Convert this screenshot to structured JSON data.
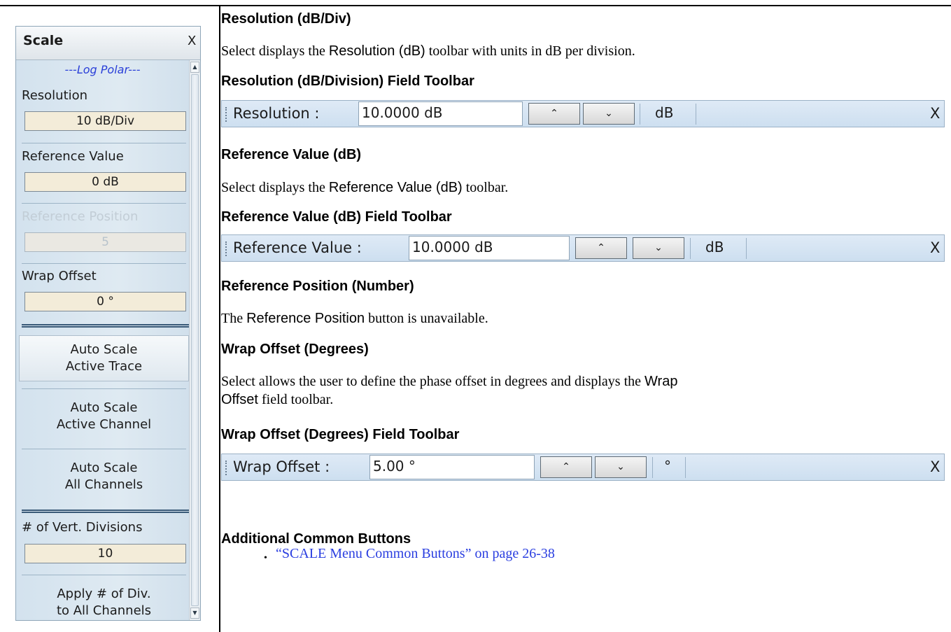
{
  "panel": {
    "title": "Scale",
    "close_label": "X",
    "subtitle": "---Log Polar---",
    "resolution": {
      "label": "Resolution",
      "value": "10 dB/Div"
    },
    "reference_value": {
      "label": "Reference Value",
      "value": "0 dB"
    },
    "reference_position": {
      "label": "Reference Position",
      "value": "5"
    },
    "wrap_offset": {
      "label": "Wrap Offset",
      "value": "0 °"
    },
    "auto_scale_trace": {
      "line1": "Auto Scale",
      "line2": "Active Trace"
    },
    "auto_scale_channel": {
      "line1": "Auto Scale",
      "line2": "Active Channel"
    },
    "auto_scale_all": {
      "line1": "Auto Scale",
      "line2": "All Channels"
    },
    "vert_divisions": {
      "label": "# of Vert. Divisions",
      "value": "10"
    },
    "apply_div": {
      "line1": "Apply # of Div.",
      "line2": "to All Channels"
    },
    "scroll_up": "▲",
    "scroll_down": "▼"
  },
  "doc": {
    "h_resolution": "Resolution (dB/Div)",
    "p_resolution_pre": "Select displays the ",
    "p_resolution_term": "Resolution (dB)",
    "p_resolution_post": " toolbar with units in dB per division.",
    "h_resolution_toolbar": "Resolution (dB/Division) Field Toolbar",
    "h_refval": "Reference Value (dB)",
    "p_refval_pre": "Select displays the ",
    "p_refval_term": "Reference Value (dB)",
    "p_refval_post": " toolbar.",
    "h_refval_toolbar": "Reference Value (dB) Field Toolbar",
    "h_refpos": "Reference Position (Number)",
    "p_refpos_pre": "The ",
    "p_refpos_term": "Reference Position",
    "p_refpos_post": " button is unavailable.",
    "h_wrap": "Wrap Offset (Degrees)",
    "p_wrap_line1_pre": "Select allows the user to define the phase offset in degrees and displays the ",
    "p_wrap_line1_term": "Wrap",
    "p_wrap_line2_term": "Offset",
    "p_wrap_line2_post": " field toolbar.",
    "h_wrap_toolbar": "Wrap Offset (Degrees) Field Toolbar",
    "h_additional": "Additional Common Buttons",
    "bullet": "•",
    "link": "“SCALE Menu Common Buttons” on page 26-38"
  },
  "toolbars": {
    "resolution": {
      "label": "Resolution :",
      "value": "10.0000  dB",
      "up": "⌃",
      "down": "⌄",
      "unit": "dB",
      "close": "X"
    },
    "refval": {
      "label": "Reference Value :",
      "value": "10.0000  dB",
      "up": "⌃",
      "down": "⌄",
      "unit": "dB",
      "close": "X"
    },
    "wrap": {
      "label": "Wrap Offset :",
      "value": "5.00 °",
      "up": "⌃",
      "down": "⌄",
      "unit": "°",
      "close": "X"
    }
  }
}
